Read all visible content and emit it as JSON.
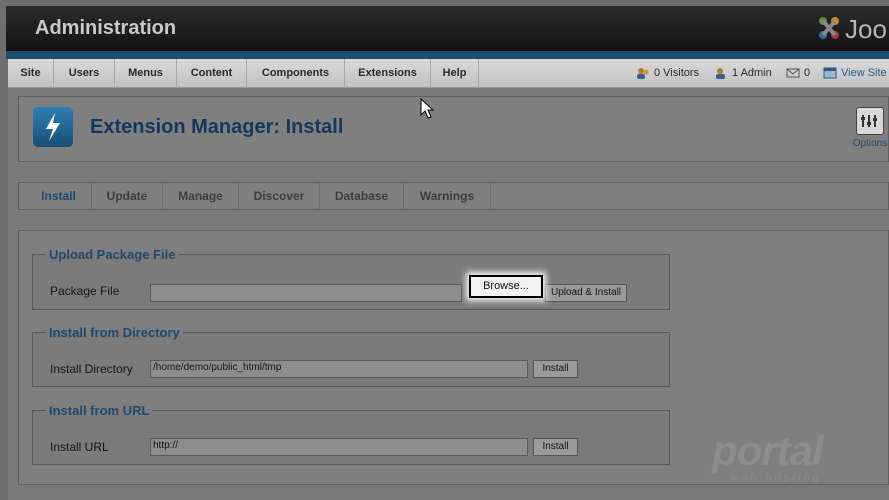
{
  "header": {
    "title": "Administration",
    "logo_text": "Joo"
  },
  "menu": {
    "items": [
      "Site",
      "Users",
      "Menus",
      "Content",
      "Components",
      "Extensions",
      "Help"
    ]
  },
  "status": {
    "visitors": "0 Visitors",
    "admins": "1 Admin",
    "messages": "0",
    "view_site": "View Site"
  },
  "page": {
    "title": "Extension Manager: Install",
    "options_label": "Options"
  },
  "tabs": [
    "Install",
    "Update",
    "Manage",
    "Discover",
    "Database",
    "Warnings"
  ],
  "upload": {
    "legend": "Upload Package File",
    "label": "Package File",
    "browse_label": "Browse...",
    "submit_label": "Upload & Install"
  },
  "directory": {
    "legend": "Install from Directory",
    "label": "Install Directory",
    "value": "/home/demo/public_html/tmp",
    "button_label": "Install"
  },
  "url": {
    "legend": "Install from URL",
    "label": "Install URL",
    "value": "http://",
    "button_label": "Install"
  },
  "watermark": {
    "main": "portal",
    "sub": "web hosting"
  }
}
